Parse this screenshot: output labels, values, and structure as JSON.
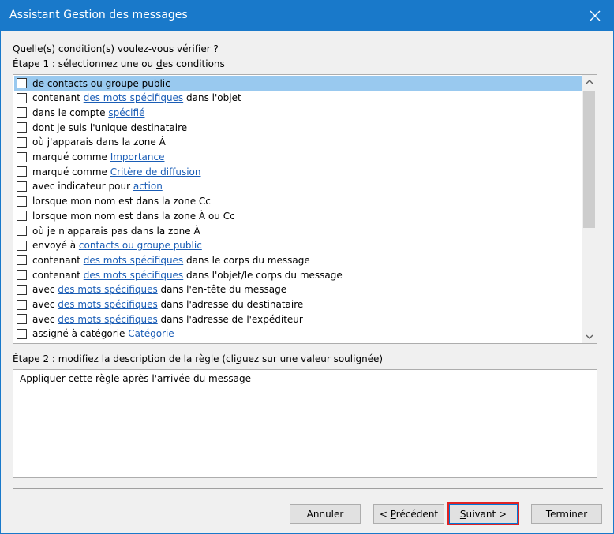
{
  "window": {
    "title": "Assistant Gestion des messages"
  },
  "question": "Quelle(s) condition(s) voulez-vous vérifier ?",
  "step1": {
    "prefix": "Étape 1 : sélectionnez une ou ",
    "accel": "d",
    "suffix": "es conditions"
  },
  "conditions": [
    {
      "before": "de ",
      "link": "contacts ou groupe public",
      "after": ""
    },
    {
      "before": "contenant ",
      "link": "des mots spécifiques",
      "after": " dans l'objet"
    },
    {
      "before": "dans le compte ",
      "link": "spécifié",
      "after": ""
    },
    {
      "before": "dont je suis l'unique destinataire",
      "link": "",
      "after": ""
    },
    {
      "before": "où j'apparais dans la zone À",
      "link": "",
      "after": ""
    },
    {
      "before": "marqué comme ",
      "link": "Importance",
      "after": ""
    },
    {
      "before": "marqué comme ",
      "link": "Critère de diffusion",
      "after": ""
    },
    {
      "before": "avec indicateur pour ",
      "link": "action ",
      "after": ""
    },
    {
      "before": "lorsque mon nom est dans la zone Cc",
      "link": "",
      "after": ""
    },
    {
      "before": "lorsque mon nom est dans la zone À ou Cc",
      "link": "",
      "after": ""
    },
    {
      "before": "où je n'apparais pas dans la zone À",
      "link": "",
      "after": ""
    },
    {
      "before": "envoyé à ",
      "link": "contacts ou groupe public",
      "after": ""
    },
    {
      "before": "contenant ",
      "link": "des mots spécifiques",
      "after": " dans le corps du message"
    },
    {
      "before": "contenant ",
      "link": "des mots spécifiques",
      "after": " dans l'objet/le corps du message"
    },
    {
      "before": "avec ",
      "link": "des mots spécifiques",
      "after": " dans l'en-tête du message"
    },
    {
      "before": "avec ",
      "link": "des mots spécifiques",
      "after": " dans l'adresse du destinataire"
    },
    {
      "before": "avec ",
      "link": "des mots spécifiques",
      "after": " dans l'adresse de l'expéditeur"
    },
    {
      "before": "assigné à catégorie ",
      "link": "Catégorie",
      "after": ""
    }
  ],
  "step2": {
    "prefix": "Étape 2 : modifiez la description de la règle (cli",
    "accel": "q",
    "suffix": "uez sur une valeur soulignée)"
  },
  "description": "Appliquer cette règle après l'arrivée du message",
  "buttons": {
    "cancel": "Annuler",
    "previous": {
      "prefix": "< ",
      "accel": "P",
      "suffix": "récédent"
    },
    "next": {
      "accel": "S",
      "suffix": "uivant >"
    },
    "finish": "Terminer"
  }
}
